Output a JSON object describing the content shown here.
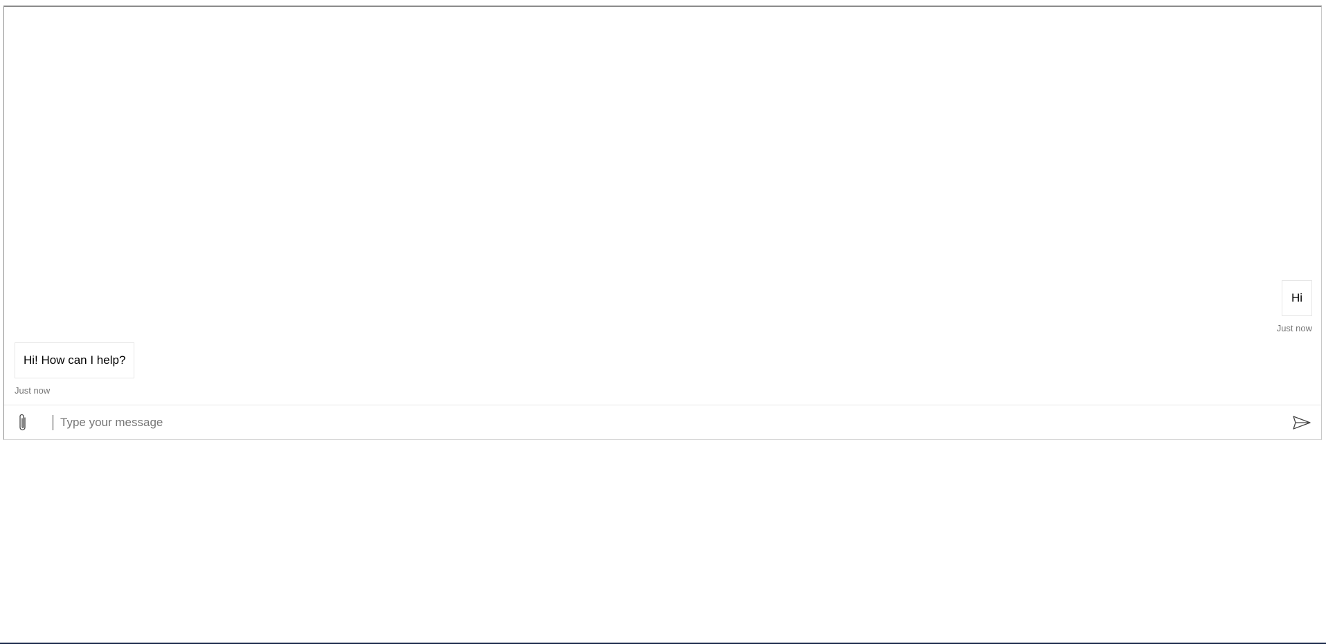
{
  "transcript": {
    "messages": [
      {
        "from": "user",
        "text": "Hi",
        "timestamp": "Just now"
      },
      {
        "from": "bot",
        "text": "Hi! How can I help?",
        "timestamp": "Just now"
      }
    ]
  },
  "composer": {
    "placeholder": "Type your message",
    "value": "",
    "attach_icon": "paperclip-icon",
    "send_icon": "send-icon"
  },
  "colors": {
    "bubble_border": "#e6e6e6",
    "timestamp": "#767676",
    "frame_border": "#8a8a8a",
    "bottom_rule": "#1b2a4a"
  }
}
